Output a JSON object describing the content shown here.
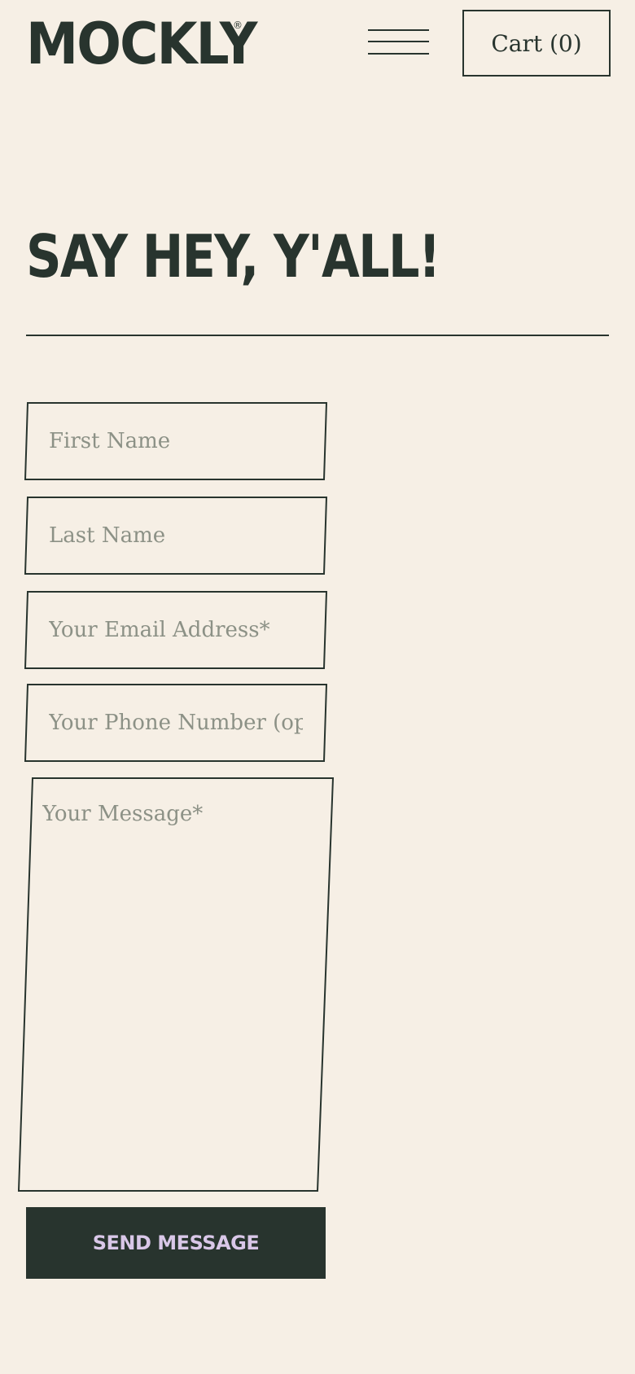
{
  "header": {
    "logo_text": "MOCKLY",
    "logo_registered_mark": "®",
    "menu_icon": "hamburger-menu-icon",
    "cart_label": "Cart (0)"
  },
  "contact": {
    "title": "SAY HEY, Y'ALL!",
    "fields": {
      "first_name_placeholder": "First Name",
      "last_name_placeholder": "Last Name",
      "email_placeholder": "Your Email Address*",
      "phone_placeholder": "Your Phone Number (optional)",
      "message_placeholder": "Your Message*"
    },
    "submit_label": "SEND MESSAGE"
  },
  "colors": {
    "background": "#f6efe5",
    "ink": "#28342e",
    "placeholder": "#8c9186",
    "button_text": "#d9c7e8"
  }
}
